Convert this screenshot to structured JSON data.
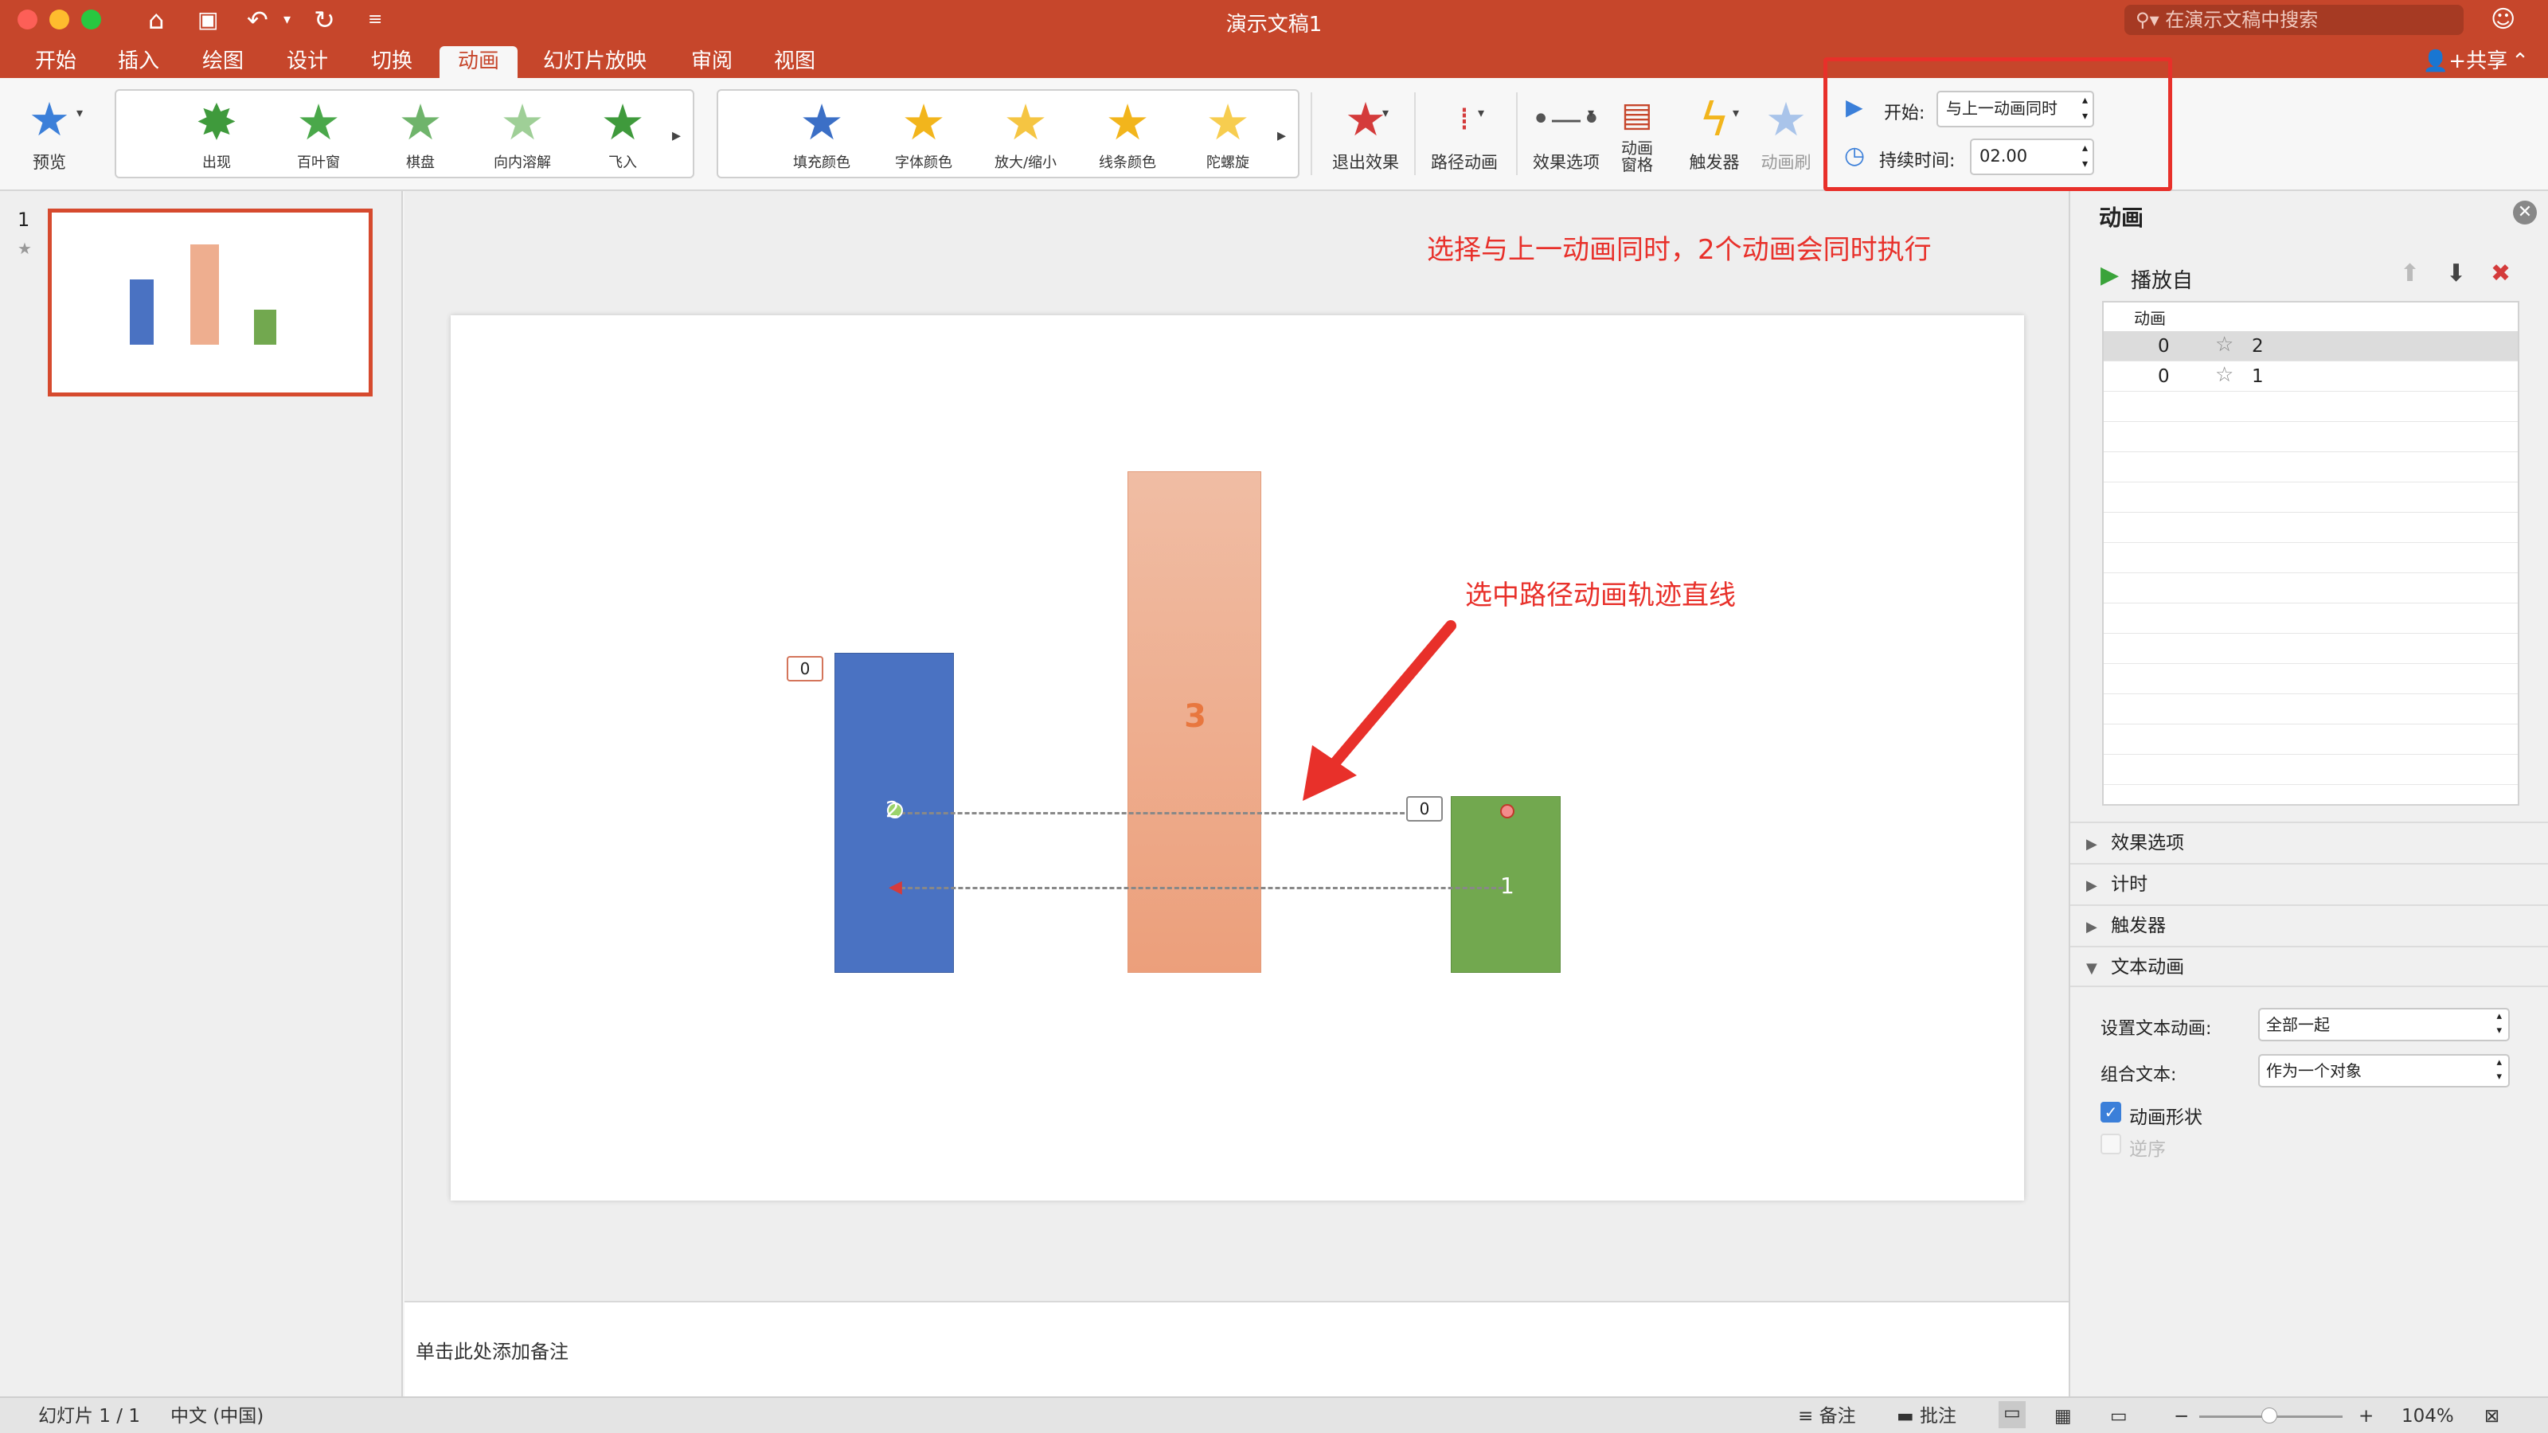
{
  "window": {
    "title": "演示文稿1",
    "search_placeholder": "在演示文稿中搜索",
    "share": "共享"
  },
  "tabs": [
    "开始",
    "插入",
    "绘图",
    "设计",
    "切换",
    "动画",
    "幻灯片放映",
    "审阅",
    "视图"
  ],
  "active_tab": "动画",
  "ribbon": {
    "preview": "预览",
    "entrance_effects": [
      "出现",
      "百叶窗",
      "棋盘",
      "向内溶解",
      "飞入"
    ],
    "emphasis_effects": [
      "填充颜色",
      "字体颜色",
      "放大/缩小",
      "线条颜色",
      "陀螺旋"
    ],
    "exit_effect": "退出效果",
    "path_animation": "路径动画",
    "effect_options": "效果选项",
    "animation_pane": "动画\n窗格",
    "trigger": "触发器",
    "animation_painter": "动画刷",
    "start_label": "开始:",
    "start_value": "与上一动画同时",
    "duration_label": "持续时间:",
    "duration_value": "02.00"
  },
  "thumbnail": {
    "number": "1"
  },
  "slide": {
    "bar_center_label": "3",
    "tag_left": "0",
    "tag_right": "0",
    "marker_blue": "2",
    "marker_green": "1"
  },
  "annotations": {
    "top": "选择与上一动画同时，2个动画会同时执行",
    "middle": "选中路径动画轨迹直线"
  },
  "notes_placeholder": "单击此处添加备注",
  "animation_pane": {
    "title": "动画",
    "play_from": "播放自",
    "column_header": "动画",
    "rows": [
      {
        "order": "0",
        "name": "2",
        "selected": true
      },
      {
        "order": "0",
        "name": "1",
        "selected": false
      }
    ],
    "sections": [
      "效果选项",
      "计时",
      "触发器",
      "文本动画"
    ],
    "text_animation_label": "设置文本动画:",
    "text_animation_value": "全部一起",
    "group_text_label": "组合文本:",
    "group_text_value": "作为一个对象",
    "animate_shape": "动画形状",
    "reverse_order": "逆序"
  },
  "status": {
    "slide_info": "幻灯片 1 / 1",
    "language": "中文 (中国)",
    "notes": "备注",
    "comments": "批注",
    "zoom": "104%"
  },
  "colors": {
    "accent": "#c6462b",
    "annotation": "#e8302a",
    "bar_blue": "#4a72c2",
    "bar_orange": "#eeae8f",
    "bar_green": "#72a84f"
  }
}
